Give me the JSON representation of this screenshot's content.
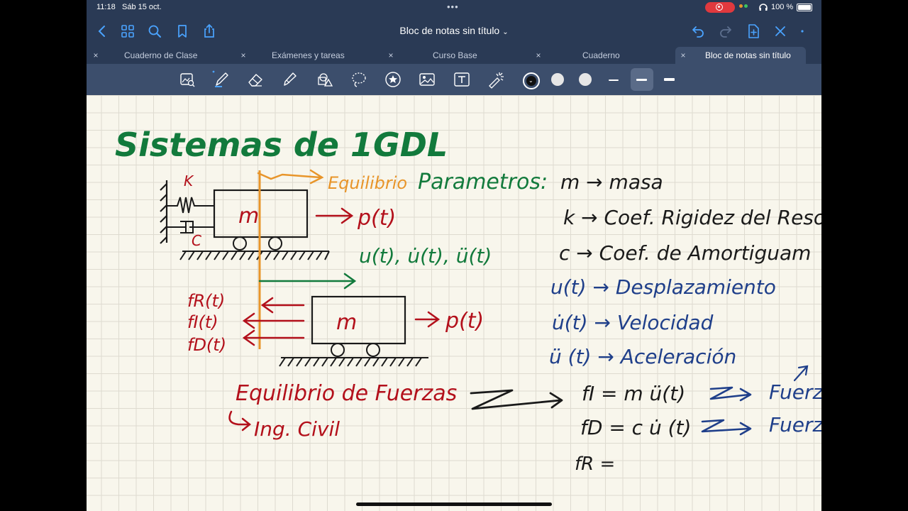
{
  "status": {
    "time": "11:18",
    "date": "Sáb 15 oct.",
    "battery": "100 %",
    "dots": "•••"
  },
  "nav": {
    "title": "Bloc de notas sin título",
    "title_chevron": "⌄",
    "icons": [
      "back-icon",
      "grid-icon",
      "search-icon",
      "bookmark-icon",
      "share-icon",
      "undo-icon",
      "redo-icon",
      "new-page-icon",
      "close-icon"
    ]
  },
  "tabs": [
    {
      "label": "Cuaderno de Clase",
      "active": false
    },
    {
      "label": "Exámenes y tareas",
      "active": false
    },
    {
      "label": "Curso Base",
      "active": false
    },
    {
      "label": "Cuaderno",
      "active": false
    },
    {
      "label": "Bloc de notas sin título",
      "active": true
    }
  ],
  "tabs_more": "❮",
  "close_glyph": "×",
  "toolbar": {
    "tools": [
      "zoom-icon",
      "pen-icon",
      "eraser-icon",
      "highlighter-icon",
      "shapes-icon",
      "lasso-icon",
      "sticker-icon",
      "image-icon",
      "text-icon",
      "laser-icon"
    ],
    "colors": [
      "#111111",
      "#e6e6e6",
      "#e6e6e6"
    ],
    "active_color": "#111111",
    "stroke_widths": [
      "thin",
      "medium",
      "thick"
    ],
    "active_stroke": "medium"
  },
  "notes": {
    "title": "Sistemas de 1GDL",
    "k_label": "K",
    "c_label": "C",
    "mass_label": "m",
    "force_p": "p(t)",
    "equilibrio": "Equilibrio",
    "parametros": "Parametros:",
    "responses": "u(t), u̇(t), ü(t)",
    "fr": "fR(t)",
    "fi": "fI(t)",
    "fd": "fD(t)",
    "equilibrio_fuerzas": "Equilibrio de Fuerzas",
    "ing_civil": "Ing. Civil",
    "params": [
      {
        "text": "m → masa",
        "color": "#1a1a1a"
      },
      {
        "text": "k → Coef. Rigidez del Reso",
        "color": "#1a1a1a"
      },
      {
        "text": "c → Coef. de Amortiguam",
        "color": "#1a1a1a"
      },
      {
        "text": "u(t) → Desplazamiento",
        "color": "#1f3f8a"
      },
      {
        "text": "u̇(t) → Velocidad",
        "color": "#1f3f8a"
      },
      {
        "text": "ü (t) → Aceleración",
        "color": "#1f3f8a"
      }
    ],
    "eq_fi": "fI = m ü(t)",
    "eq_fd": "fD = c u̇ (t)",
    "eq_fr": "fR =",
    "fuerza_1": "Fuerz",
    "fuerza_2": "Fuerz"
  },
  "colors": {
    "title_green": "#127a3c",
    "red": "#b3101b",
    "orange": "#e8952a",
    "blue": "#1f3f8a",
    "black": "#1a1a1a",
    "chrome": "#2a3a55",
    "toolbar": "#3c4e6c"
  }
}
